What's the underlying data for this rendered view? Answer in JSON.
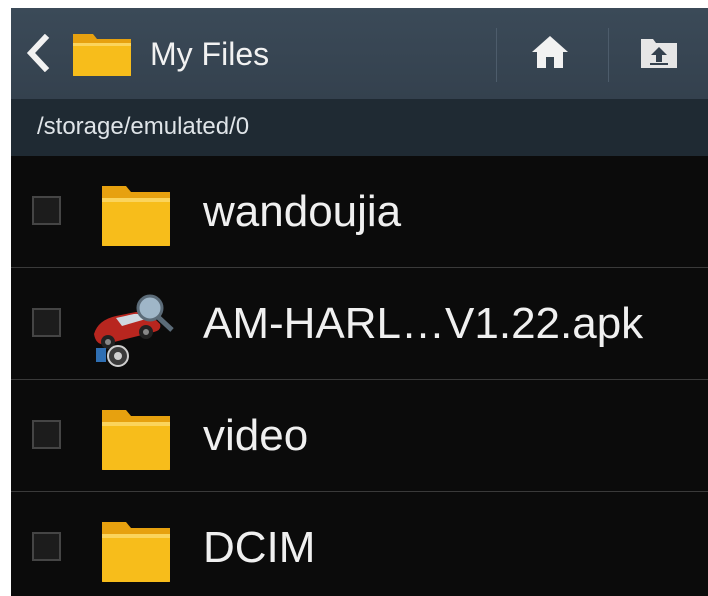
{
  "actionbar": {
    "title": "My Files",
    "icons": [
      "back-chevron-icon",
      "folder-icon",
      "home-icon",
      "folder-up-icon"
    ],
    "colors": {
      "background": "#3b4a58",
      "folder": "#f5b819"
    }
  },
  "pathbar": {
    "path": "/storage/emulated/0"
  },
  "files": [
    {
      "name": "wandoujia",
      "icon": "folder-icon",
      "checked": false
    },
    {
      "name": "AM-HARL…V1.22.apk",
      "icon": "apk-car-icon",
      "checked": false
    },
    {
      "name": "video",
      "icon": "folder-icon",
      "checked": false
    },
    {
      "name": "DCIM",
      "icon": "folder-icon",
      "checked": false
    }
  ]
}
